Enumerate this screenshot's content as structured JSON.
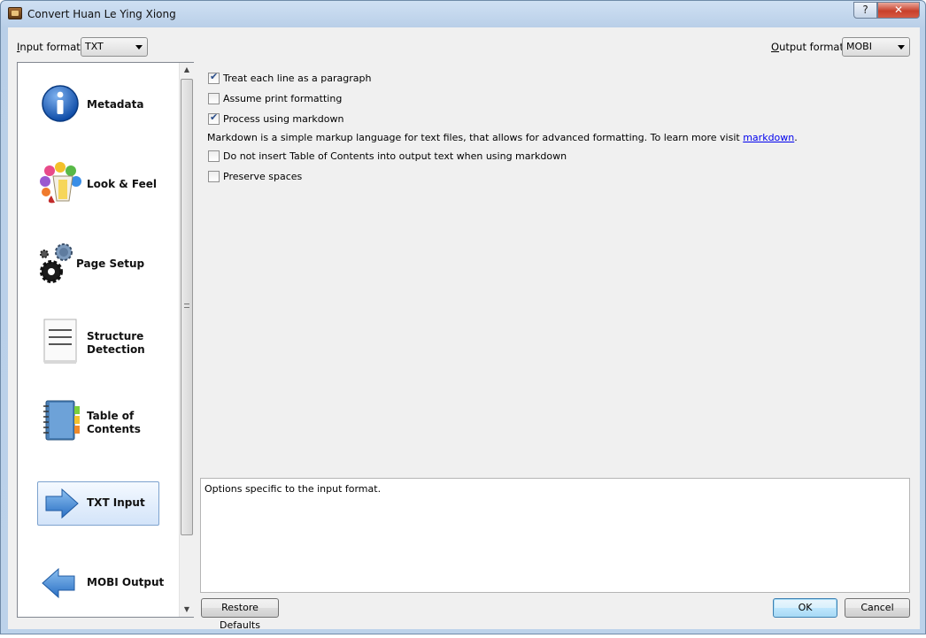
{
  "window": {
    "title": "Convert Huan Le Ying Xiong",
    "help_label": "?",
    "close_label": "✕"
  },
  "input_format": {
    "label": "Input format:",
    "value": "TXT"
  },
  "output_format": {
    "label": "Output format:",
    "value": "MOBI"
  },
  "sidebar": {
    "items": [
      {
        "label": "Metadata",
        "icon": "info-icon"
      },
      {
        "label": "Look & Feel",
        "icon": "paint-icon"
      },
      {
        "label": "Page Setup",
        "icon": "gears-icon"
      },
      {
        "label_line1": "Structure",
        "label_line2": "Detection",
        "icon": "document-icon"
      },
      {
        "label_line1": "Table of",
        "label_line2": "Contents",
        "icon": "notebook-icon"
      },
      {
        "label": "TXT Input",
        "icon": "arrow-right-icon",
        "selected": true
      },
      {
        "label": "MOBI Output",
        "icon": "arrow-left-icon"
      }
    ]
  },
  "options": {
    "treat_each_line": {
      "label": "Treat each line as a paragraph",
      "checked": true
    },
    "assume_print": {
      "label": "Assume print formatting",
      "checked": false
    },
    "process_markdown": {
      "label": "Process using markdown",
      "checked": true
    },
    "markdown_info": "Markdown is a simple markup language for text files, that allows for advanced formatting. To learn more visit",
    "markdown_link": "markdown",
    "markdown_info_end": ".",
    "no_toc": {
      "label": "Do not insert Table of Contents into output text when using markdown",
      "checked": false
    },
    "preserve_spaces": {
      "label": "Preserve spaces",
      "checked": false
    }
  },
  "help_text": "Options specific to the input format.",
  "buttons": {
    "restore_defaults": "Restore Defaults",
    "ok": "OK",
    "cancel": "Cancel"
  },
  "colors": {
    "accent": "#2f6fbf",
    "selection": "#d3e4f9"
  }
}
